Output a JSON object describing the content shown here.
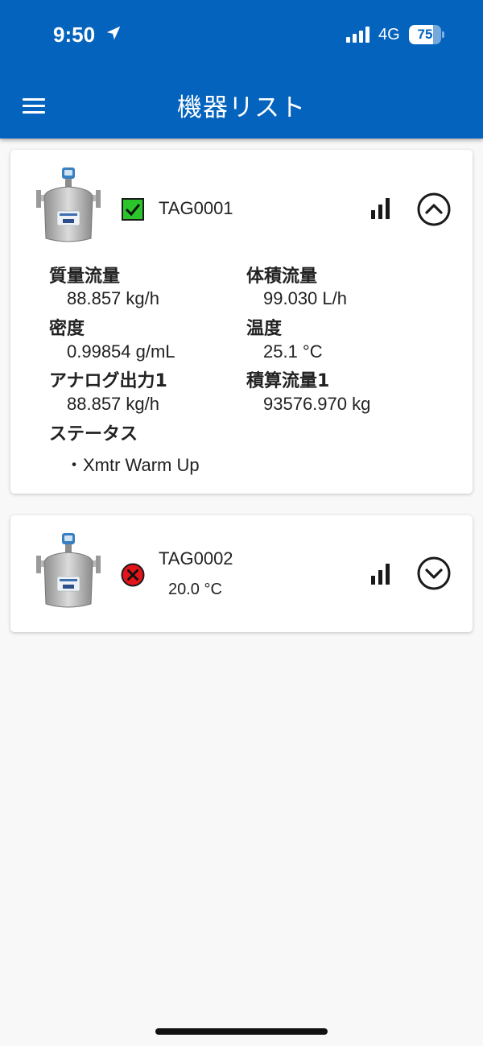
{
  "status_bar": {
    "time": "9:50",
    "network": "4G",
    "battery": "75",
    "battery_level": 0.75
  },
  "header": {
    "title": "機器リスト"
  },
  "devices": [
    {
      "tag": "TAG0001",
      "status": "ok",
      "expanded": true,
      "fields": [
        {
          "label": "質量流量",
          "value": "88.857 kg/h"
        },
        {
          "label": "体積流量",
          "value": "99.030 L/h"
        },
        {
          "label": "密度",
          "value": "0.99854 g/mL"
        },
        {
          "label": "温度",
          "value": "25.1 °C"
        },
        {
          "label": "アナログ出力1",
          "value": "88.857 kg/h"
        },
        {
          "label": "積算流量1",
          "value": "93576.970 kg"
        }
      ],
      "status_label": "ステータス",
      "status_items": [
        "・Xmtr Warm Up"
      ]
    },
    {
      "tag": "TAG0002",
      "status": "error",
      "expanded": false,
      "summary": "20.0 °C"
    }
  ],
  "icons": {
    "menu": "hamburger-menu-icon",
    "signal": "signal-strength-icon",
    "collapse": "chevron-up-circle-icon",
    "expand": "chevron-down-circle-icon",
    "ok": "check-icon",
    "error": "error-x-icon"
  },
  "colors": {
    "app_bar": "#0463bd",
    "ok_green": "#2bc52b",
    "error_red": "#e5141b",
    "background": "#f8f8f8"
  }
}
